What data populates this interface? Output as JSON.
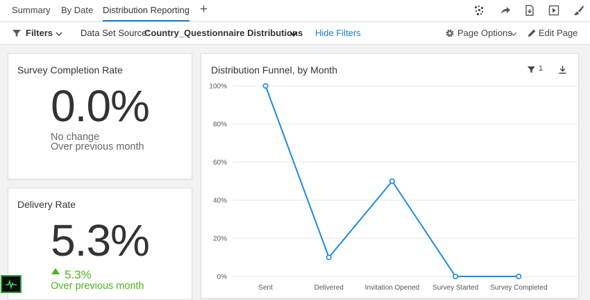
{
  "tabs": [
    {
      "label": "Summary"
    },
    {
      "label": "By Date"
    },
    {
      "label": "Distribution Reporting"
    }
  ],
  "filterbar": {
    "filters_label": "Filters",
    "dataset_prefix": "Data Set Source:",
    "dataset_value": "Country_Questionnaire Distributions",
    "hide_filters": "Hide Filters",
    "page_options": "Page Options",
    "edit_page": "Edit Page"
  },
  "cards": {
    "completion": {
      "title": "Survey Completion Rate",
      "value": "0.0%",
      "change": "No change",
      "period": "Over previous month"
    },
    "delivery": {
      "title": "Delivery Rate",
      "value": "5.3%",
      "change": "5.3%",
      "period": "Over previous month"
    }
  },
  "chart": {
    "title": "Distribution Funnel, by Month",
    "filter_count": "1"
  },
  "colors": {
    "accent": "#1a7ccf",
    "line": "#1f88e5",
    "positive": "#4db41e"
  },
  "chart_data": {
    "type": "line",
    "title": "Distribution Funnel, by Month",
    "categories": [
      "Sent",
      "Delivered",
      "Invitation Opened",
      "Survey Started",
      "Survey Completed"
    ],
    "series": [
      {
        "values": [
          100,
          10,
          50,
          0,
          0
        ]
      }
    ],
    "yticks": [
      "100%",
      "80%",
      "60%",
      "40%",
      "20%",
      "0%"
    ],
    "ylim": [
      0,
      100
    ],
    "grid": true,
    "xlabel": "",
    "ylabel": ""
  }
}
